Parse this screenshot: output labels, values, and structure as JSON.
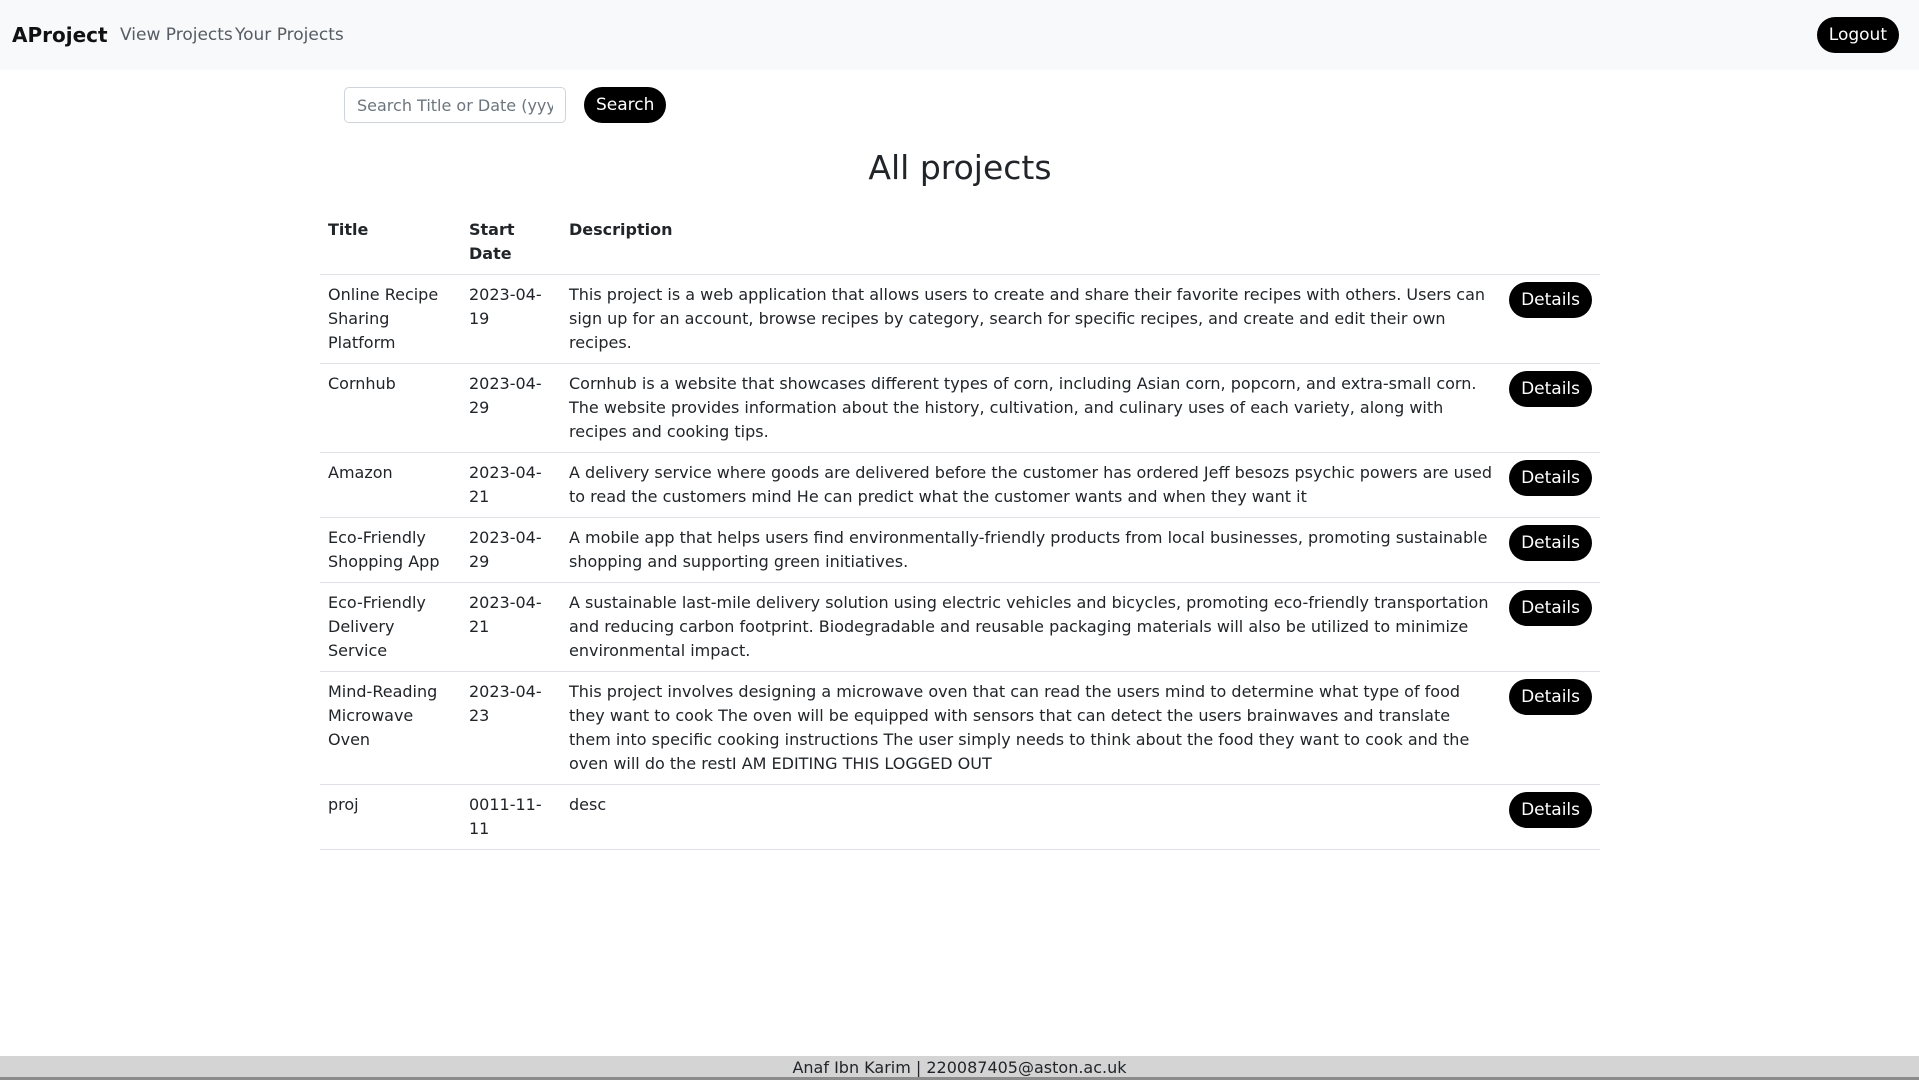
{
  "navbar": {
    "brand": "AProject",
    "links": [
      {
        "label": "View Projects"
      },
      {
        "label": "Your Projects"
      }
    ],
    "logout_label": "Logout"
  },
  "search": {
    "placeholder": "Search Title or Date (yyyy-mm-dd)",
    "value": "",
    "button_label": "Search"
  },
  "page_title": "All projects",
  "table": {
    "headers": {
      "title": "Title",
      "start_date": "Start Date",
      "description": "Description"
    },
    "details_label": "Details",
    "rows": [
      {
        "title": "Online Recipe Sharing Platform",
        "start_date": "2023-04-19",
        "description": "This project is a web application that allows users to create and share their favorite recipes with others. Users can sign up for an account, browse recipes by category, search for specific recipes, and create and edit their own recipes."
      },
      {
        "title": "Cornhub",
        "start_date": "2023-04-29",
        "description": "Cornhub is a website that showcases different types of corn, including Asian corn, popcorn, and extra-small corn. The website provides information about the history, cultivation, and culinary uses of each variety, along with recipes and cooking tips."
      },
      {
        "title": "Amazon",
        "start_date": "2023-04-21",
        "description": "A delivery service where goods are delivered before the customer has ordered Jeff besozs psychic powers are used to read the customers mind He can predict what the customer wants and when they want it"
      },
      {
        "title": "Eco-Friendly Shopping App",
        "start_date": "2023-04-29",
        "description": "A mobile app that helps users find environmentally-friendly products from local businesses, promoting sustainable shopping and supporting green initiatives."
      },
      {
        "title": "Eco-Friendly Delivery Service",
        "start_date": "2023-04-21",
        "description": "A sustainable last-mile delivery solution using electric vehicles and bicycles, promoting eco-friendly transportation and reducing carbon footprint. Biodegradable and reusable packaging materials will also be utilized to minimize environmental impact."
      },
      {
        "title": "Mind-Reading Microwave Oven",
        "start_date": "2023-04-23",
        "description": "This project involves designing a microwave oven that can read the users mind to determine what type of food they want to cook The oven will be equipped with sensors that can detect the users brainwaves and translate them into specific cooking instructions The user simply needs to think about the food they want to cook and the oven will do the restI AM EDITING THIS LOGGED OUT"
      },
      {
        "title": "proj",
        "start_date": "0011-11-11",
        "description": "desc"
      }
    ]
  },
  "footer": {
    "text": "Anaf Ibn Karim | 220087405@aston.ac.uk"
  }
}
